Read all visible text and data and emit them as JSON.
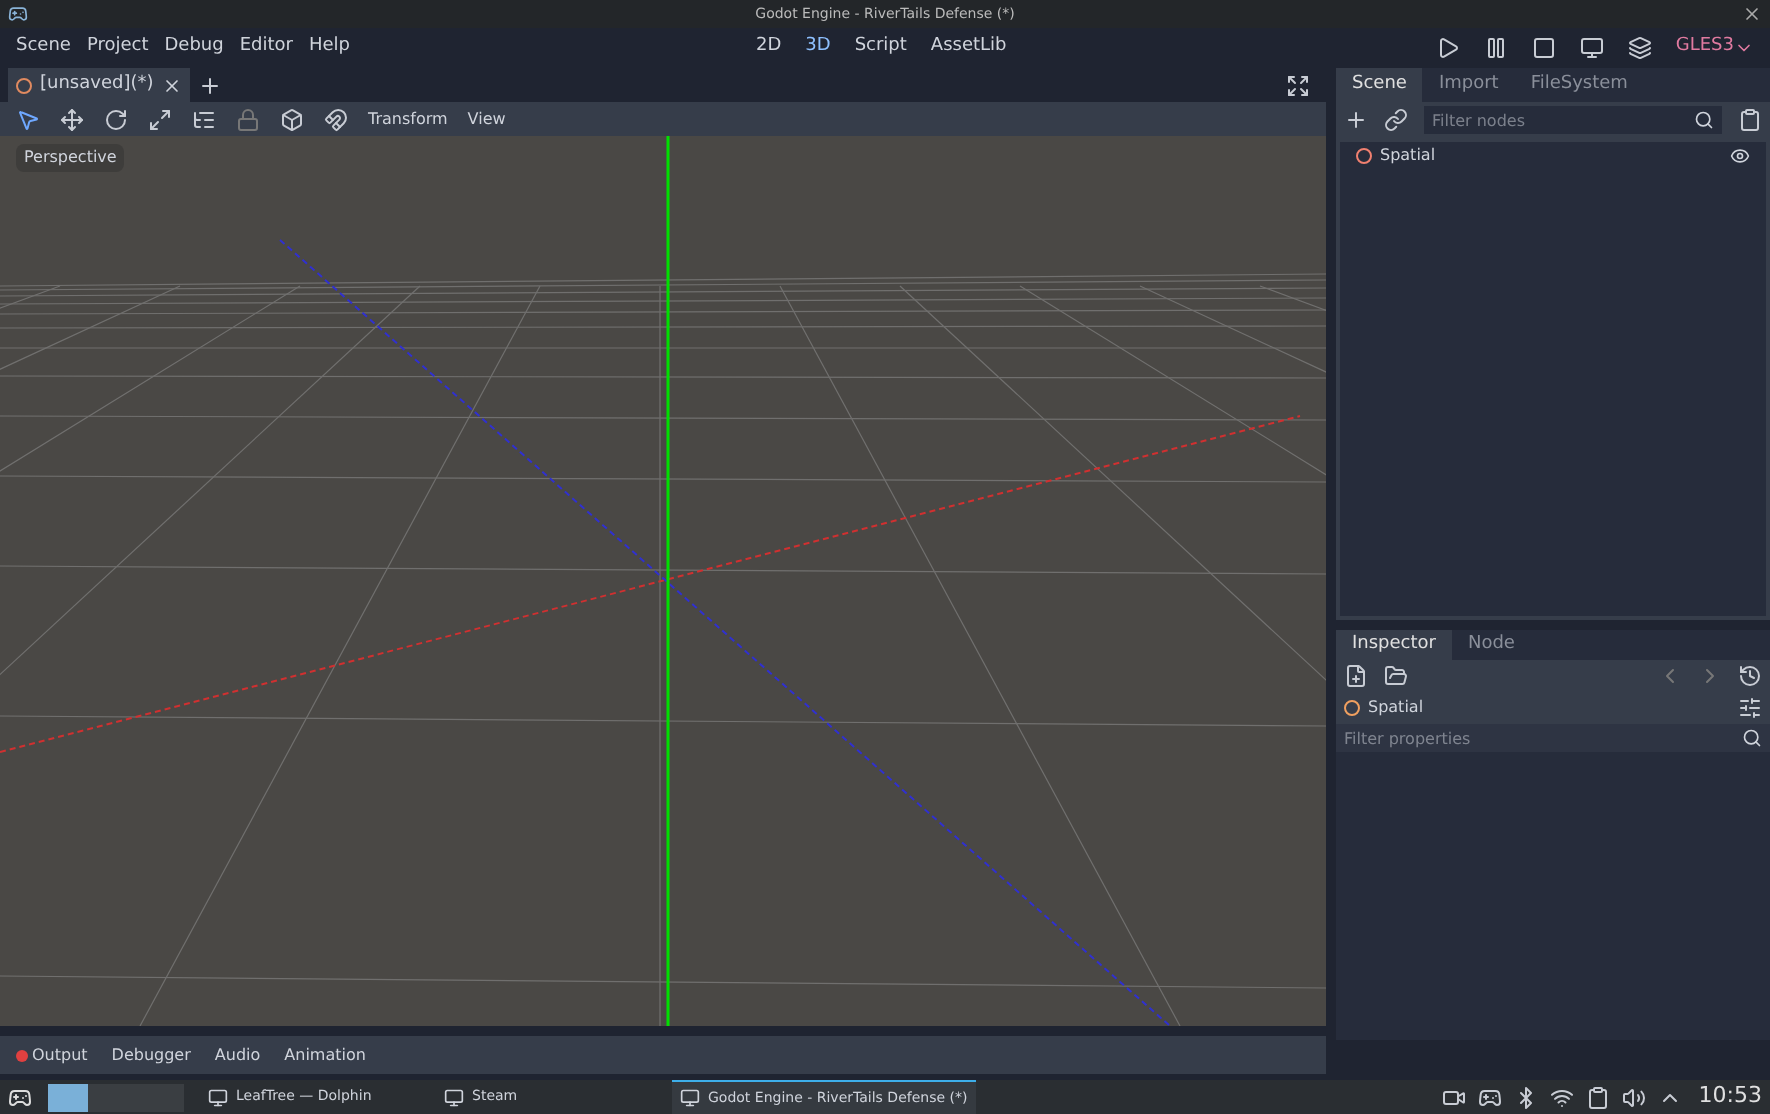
{
  "window": {
    "title": "Godot Engine - RiverTails Defense (*)"
  },
  "menu": [
    "Scene",
    "Project",
    "Debug",
    "Editor",
    "Help"
  ],
  "workspaces": [
    {
      "label": "2D",
      "selected": false
    },
    {
      "label": "3D",
      "selected": true
    },
    {
      "label": "Script",
      "selected": false
    },
    {
      "label": "AssetLib",
      "selected": false
    }
  ],
  "renderer": "GLES3",
  "scene_tabs": [
    {
      "label": "[unsaved](*)",
      "selected": true
    }
  ],
  "viewport_menus": [
    "Transform",
    "View"
  ],
  "viewport": {
    "label": "Perspective"
  },
  "scene_dock": {
    "tabs": [
      {
        "label": "Scene",
        "selected": true
      },
      {
        "label": "Import",
        "selected": false
      },
      {
        "label": "FileSystem",
        "selected": false
      }
    ],
    "filter": {
      "placeholder": "Filter nodes"
    },
    "tree": [
      {
        "name": "Spatial"
      }
    ]
  },
  "inspector": {
    "tabs": [
      {
        "label": "Inspector",
        "selected": true
      },
      {
        "label": "Node",
        "selected": false
      }
    ],
    "node": "Spatial",
    "filter": {
      "placeholder": "Filter properties"
    }
  },
  "bottom_tabs": [
    "Output",
    "Debugger",
    "Audio",
    "Animation"
  ],
  "taskbar": {
    "tasks": [
      {
        "label": "LeafTree — Dolphin",
        "selected": false
      },
      {
        "label": "Steam",
        "selected": false
      },
      {
        "label": "Godot Engine - RiverTails Defense (*)",
        "selected": true
      }
    ],
    "clock": "10:53"
  }
}
